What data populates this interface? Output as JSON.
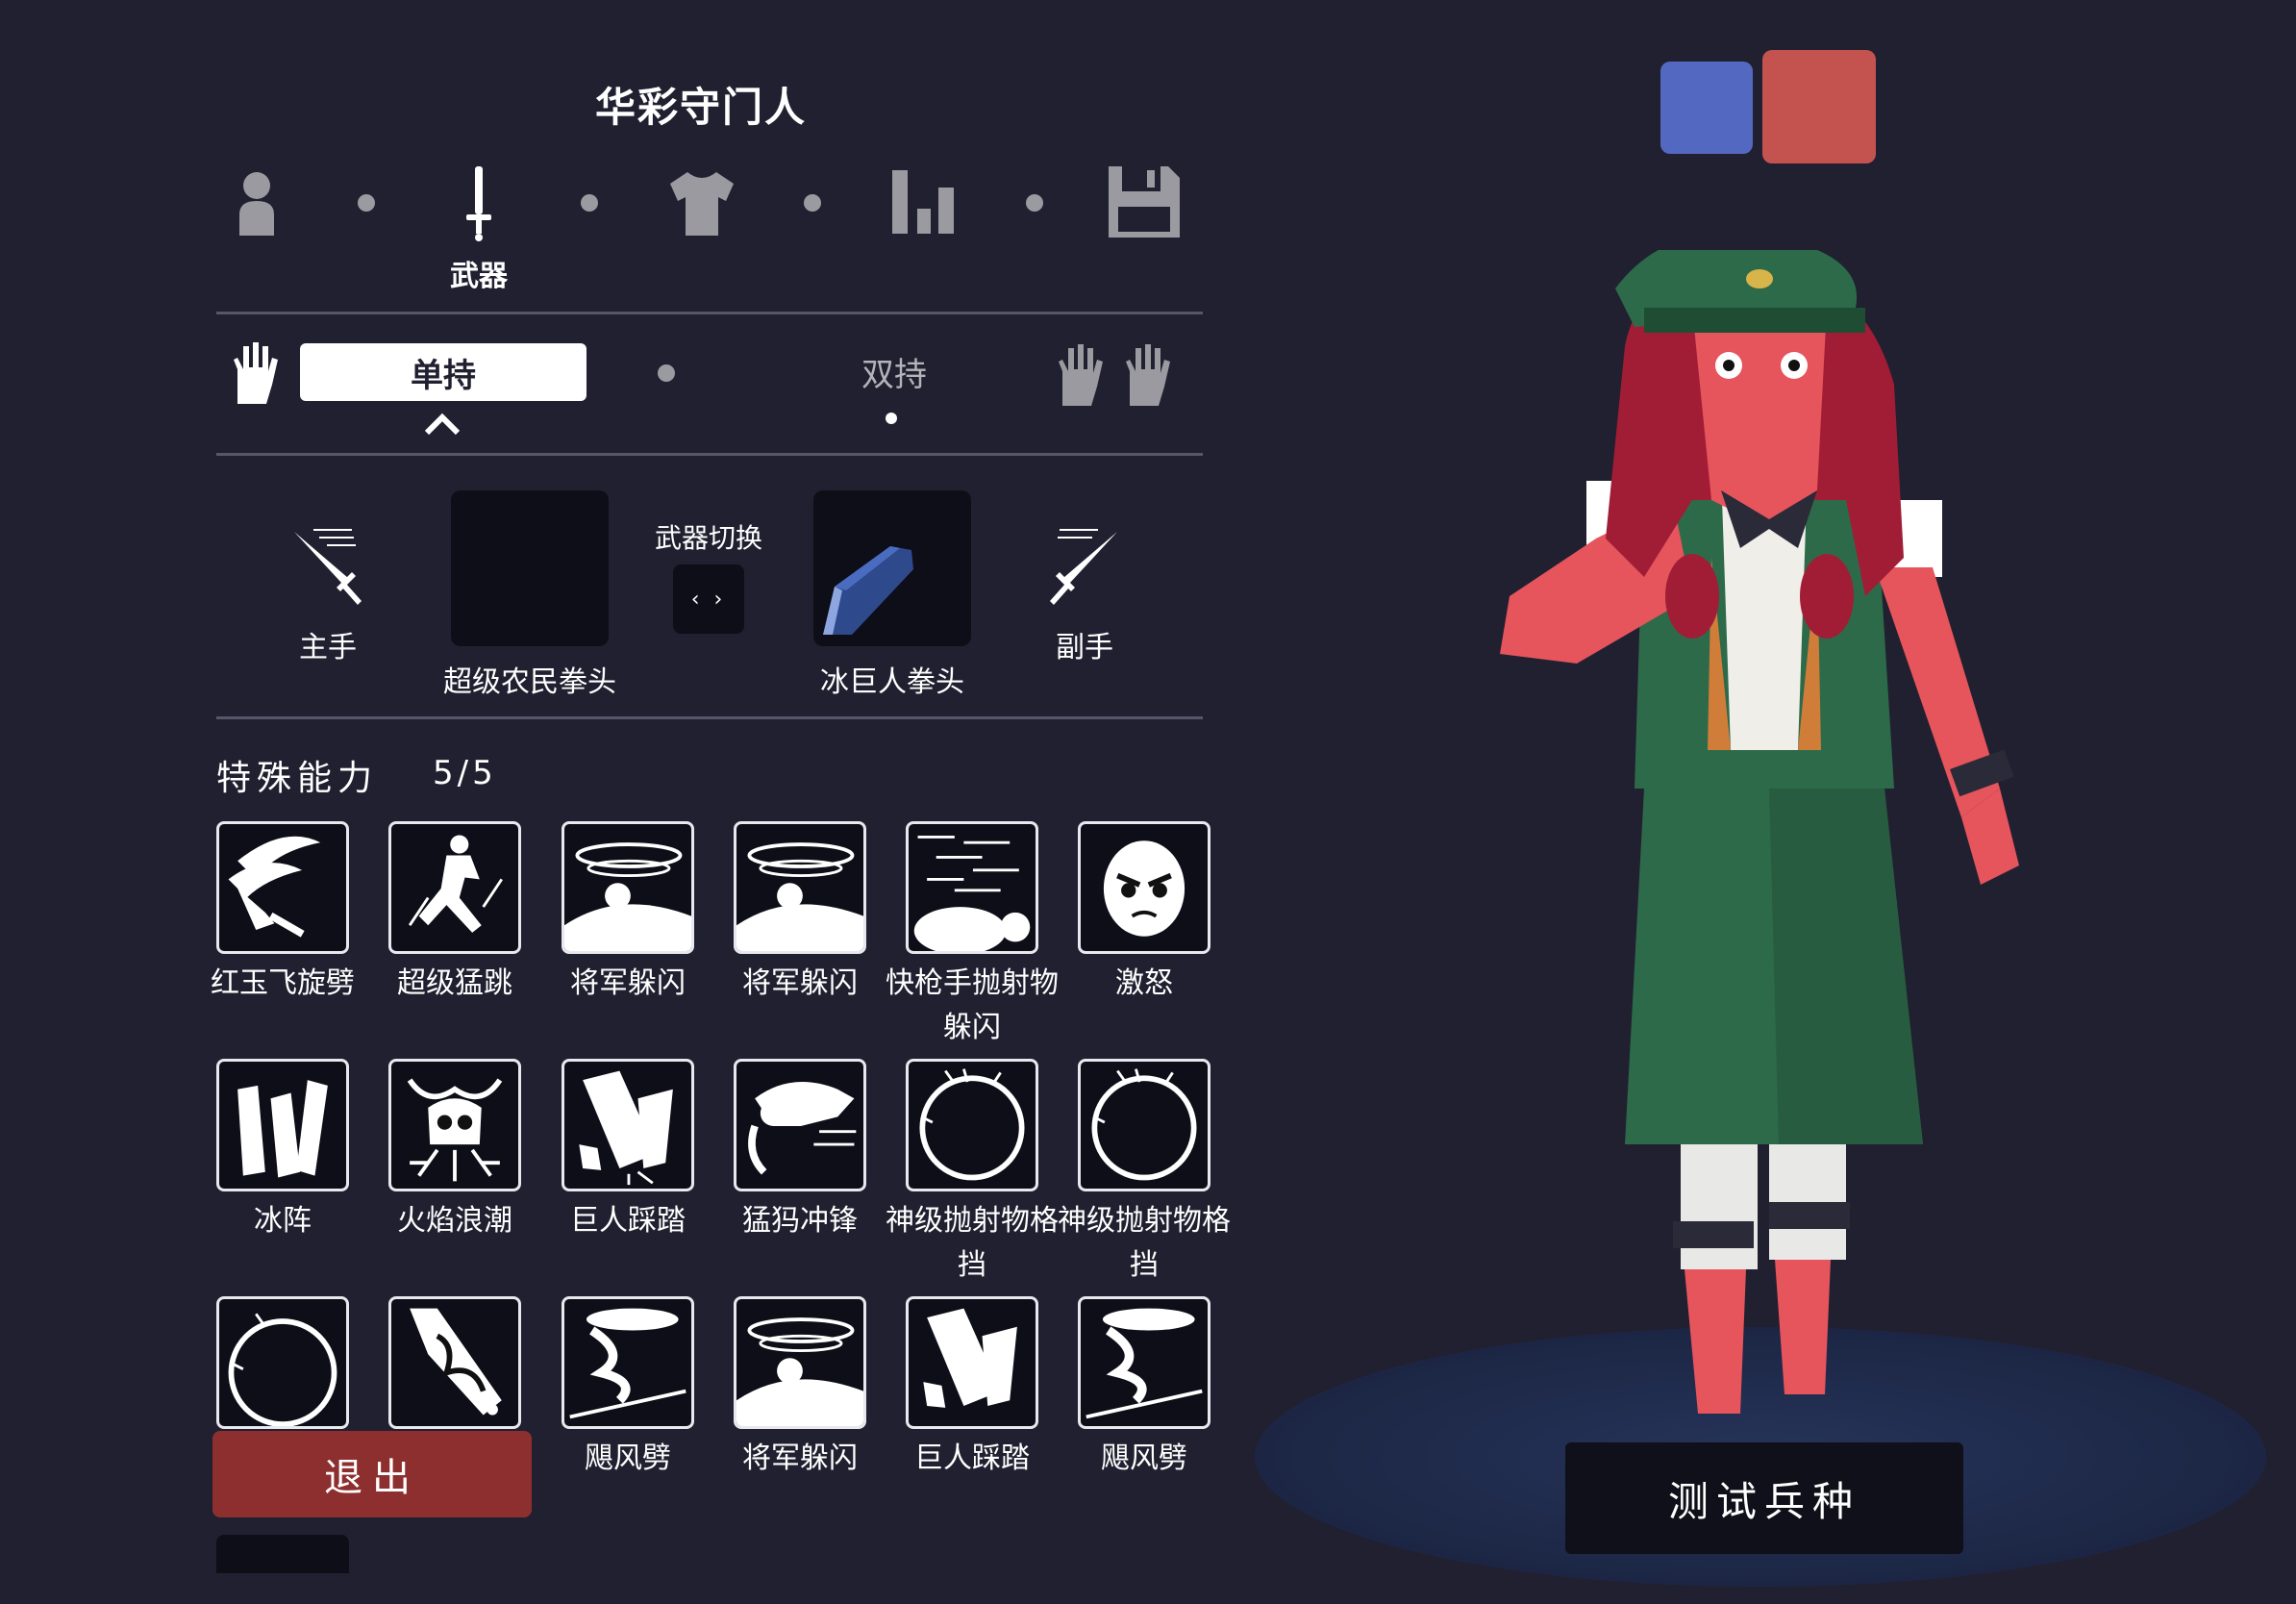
{
  "unit": {
    "title": "华彩守门人"
  },
  "steps": {
    "items": [
      {
        "icon": "person-icon"
      },
      {
        "icon": "sword-icon",
        "label": "武器"
      },
      {
        "icon": "shirt-icon"
      },
      {
        "icon": "bar-stats-icon"
      },
      {
        "icon": "floppy-save-icon"
      }
    ],
    "active_label": "武器"
  },
  "grip": {
    "single": "单持",
    "dual": "双持"
  },
  "weapons": {
    "main_hand": "主手",
    "off_hand": "副手",
    "swap": "武器切换",
    "slot_left": "超级农民拳头",
    "slot_right": "冰巨人拳头"
  },
  "abilities": {
    "title": "特殊能力",
    "count": "5/5",
    "items": [
      {
        "label": "红玉飞旋劈"
      },
      {
        "label": "超级猛跳"
      },
      {
        "label": "将军躲闪"
      },
      {
        "label": "将军躲闪"
      },
      {
        "label": "快枪手抛射物躲闪"
      },
      {
        "label": "激怒"
      },
      {
        "label": "冰阵"
      },
      {
        "label": "火焰浪潮"
      },
      {
        "label": "巨人踩踏"
      },
      {
        "label": "猛犸冲锋"
      },
      {
        "label": "神级抛射物格挡"
      },
      {
        "label": "神级抛射物格挡"
      },
      {
        "label": ""
      },
      {
        "label": ""
      },
      {
        "label": "飓风劈"
      },
      {
        "label": "将军躲闪"
      },
      {
        "label": "巨人踩踏"
      },
      {
        "label": "飓风劈"
      }
    ]
  },
  "buttons": {
    "exit": "退出",
    "test_unit": "测试兵种"
  },
  "colors": {
    "background": "#212030",
    "team_blue": "#5369c1",
    "team_red": "#c45350",
    "exit": "#8e2f2f"
  }
}
